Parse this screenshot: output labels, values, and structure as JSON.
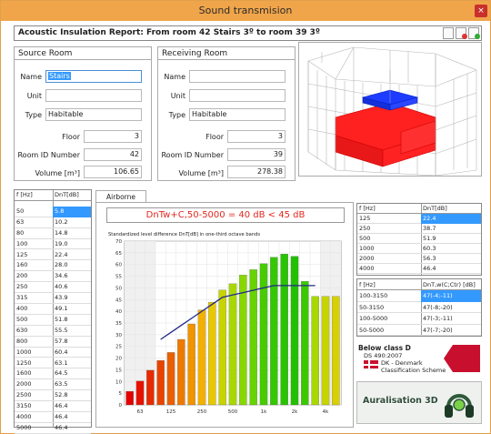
{
  "window": {
    "title": "Sound transmision",
    "close_glyph": "×"
  },
  "report": {
    "title": "Acoustic Insulation Report: From room 42 Stairs 3º  to room 39  3º"
  },
  "source": {
    "heading": "Source Room",
    "name_label": "Name",
    "name_value": "Stairs",
    "unit_label": "Unit",
    "unit_value": "",
    "type_label": "Type",
    "type_value": "Habitable",
    "floor_label": "Floor",
    "floor_value": "3",
    "roomid_label": "Room ID Number",
    "roomid_value": "42",
    "volume_label": "Volume [m³]",
    "volume_value": "106.65"
  },
  "receiving": {
    "heading": "Receiving Room",
    "name_label": "Name",
    "name_value": "",
    "unit_label": "Unit",
    "unit_value": "",
    "type_label": "Type",
    "type_value": "Habitable",
    "floor_label": "Floor",
    "floor_value": "3",
    "roomid_label": "Room ID Number",
    "roomid_value": "39",
    "volume_label": "Volume [m³]",
    "volume_value": "278.38"
  },
  "left_table": {
    "h1": "f [Hz]",
    "h2": "DnT[dB]",
    "rows": [
      [
        "50",
        "5.8"
      ],
      [
        "63",
        "10.2"
      ],
      [
        "80",
        "14.8"
      ],
      [
        "100",
        "19.0"
      ],
      [
        "125",
        "22.4"
      ],
      [
        "160",
        "28.0"
      ],
      [
        "200",
        "34.6"
      ],
      [
        "250",
        "40.6"
      ],
      [
        "315",
        "43.9"
      ],
      [
        "400",
        "49.1"
      ],
      [
        "500",
        "51.8"
      ],
      [
        "630",
        "55.5"
      ],
      [
        "800",
        "57.8"
      ],
      [
        "1000",
        "60.4"
      ],
      [
        "1250",
        "63.1"
      ],
      [
        "1600",
        "64.5"
      ],
      [
        "2000",
        "63.5"
      ],
      [
        "2500",
        "52.8"
      ],
      [
        "3150",
        "46.4"
      ],
      [
        "4000",
        "46.4"
      ],
      [
        "5000",
        "46.4"
      ]
    ]
  },
  "tab_label": "Airborne Noise",
  "result_text": "DnTw+C,50-5000 = 40 dB < 45 dB",
  "chart_data": {
    "type": "bar",
    "title": "Standardized level difference DnT[dB] in one-third octave bands",
    "categories": [
      "50",
      "63",
      "80",
      "100",
      "125",
      "160",
      "200",
      "250",
      "315",
      "400",
      "500",
      "630",
      "800",
      "1000",
      "1250",
      "1600",
      "2000",
      "2500",
      "3150",
      "4000",
      "5000"
    ],
    "values": [
      5.8,
      10.2,
      14.8,
      19.0,
      22.4,
      28.0,
      34.6,
      40.6,
      43.9,
      49.1,
      51.8,
      55.5,
      57.8,
      60.4,
      63.1,
      64.5,
      63.5,
      52.8,
      46.4,
      46.4,
      46.4
    ],
    "reference_curve": {
      "x_from": "100",
      "x_to": "3150",
      "values": [
        28,
        31,
        34,
        37,
        40,
        43,
        46,
        47,
        48,
        49,
        50,
        51,
        51,
        51,
        51,
        51
      ]
    },
    "x_tick_labels": [
      "63",
      "125",
      "250",
      "500",
      "1k",
      "2k",
      "4k"
    ],
    "y_ticks": [
      0,
      5,
      10,
      15,
      20,
      25,
      30,
      35,
      40,
      45,
      50,
      55,
      60,
      65,
      70
    ],
    "ylim": [
      0,
      70
    ],
    "grid": true
  },
  "right_table1": {
    "h1": "f [Hz]",
    "h2": "DnT[dB]",
    "rows": [
      [
        "125",
        "22.4"
      ],
      [
        "250",
        "38.7"
      ],
      [
        "500",
        "51.9"
      ],
      [
        "1000",
        "60.3"
      ],
      [
        "2000",
        "56.3"
      ],
      [
        "4000",
        "46.4"
      ]
    ]
  },
  "right_table2": {
    "h1": "f [Hz]",
    "h2": "DnT,w(C;Ctr) [dB]",
    "rows": [
      [
        "100-3150",
        "47(-4;-11)"
      ],
      [
        "50-3150",
        "47(-8;-20)"
      ],
      [
        "100-5000",
        "47(-3;-11)"
      ],
      [
        "50-5000",
        "47(-7;-20)"
      ]
    ]
  },
  "classification": {
    "line1": "Below class D",
    "line2": "DS 490:2007",
    "line3": "DK - Denmark",
    "line4": "Classification Scheme",
    "arrow_color": "#c8102e"
  },
  "auralisation": {
    "label": "Auralisation 3D"
  },
  "colors": {
    "title_bar": "#f0a54a",
    "selection": "#3399ff",
    "result_text": "#e0281f",
    "curve": "#1f2a8a"
  }
}
